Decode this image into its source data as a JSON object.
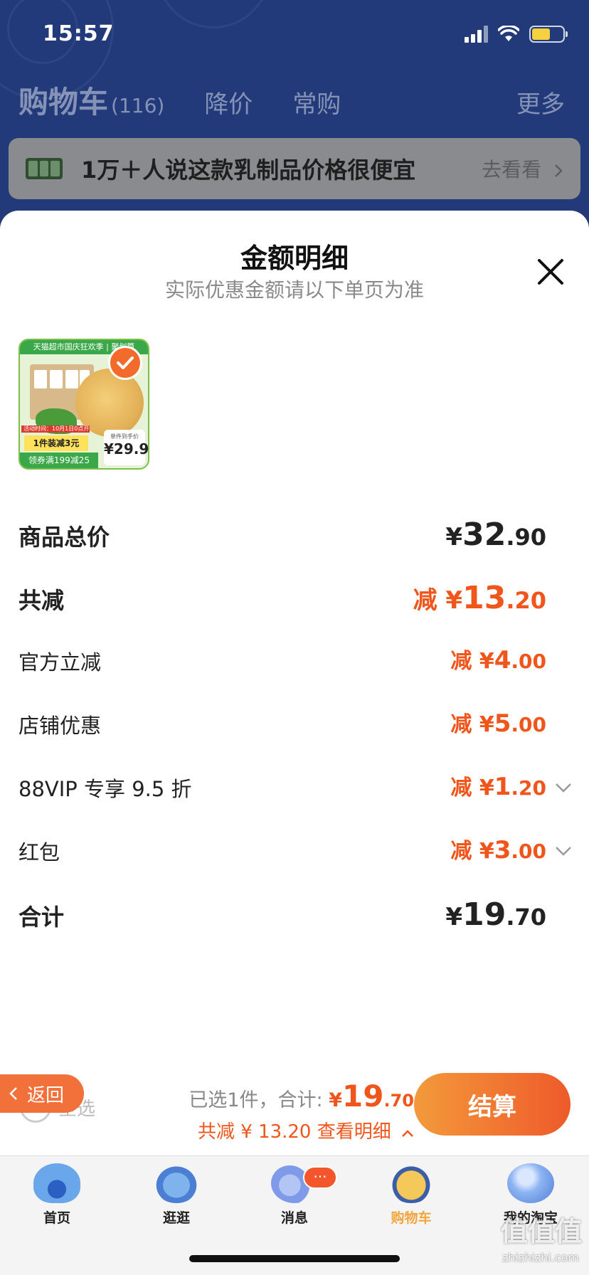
{
  "status_bar": {
    "time": "15:57"
  },
  "cart_header": {
    "title": "购物车",
    "count": "(116)",
    "tabs": [
      "降价",
      "常购"
    ],
    "more": "更多"
  },
  "promo": {
    "text": "1万＋人说这款乳制品价格很便宜",
    "link": "去看看"
  },
  "sheet": {
    "title": "金额明细",
    "subtitle": "实际优惠金额请以下单页为准",
    "product": {
      "banner": "天猫超市国庆狂欢季 | 聚划算",
      "event": "活动时间：10月1日0点开抢",
      "tag1": "1件装减3元",
      "tag2": "领券满199减25",
      "price_label": "单件到手价",
      "price": "¥29.9"
    },
    "rows": [
      {
        "label": "商品总价",
        "prefix": "",
        "currency": "¥",
        "int": "32",
        "dec": ".90"
      },
      {
        "label": "共减",
        "prefix": "减 ",
        "currency": "¥",
        "int": "13",
        "dec": ".20"
      },
      {
        "label": "官方立减",
        "prefix": "减 ",
        "currency": "¥",
        "int": "4",
        "dec": ".00"
      },
      {
        "label": "店铺优惠",
        "prefix": "减 ",
        "currency": "¥",
        "int": "5",
        "dec": ".00"
      },
      {
        "label": "88VIP 专享 9.5 折",
        "prefix": "减 ",
        "currency": "¥",
        "int": "1",
        "dec": ".20"
      },
      {
        "label": "红包",
        "prefix": "减 ",
        "currency": "¥",
        "int": "3",
        "dec": ".00"
      },
      {
        "label": "合计",
        "prefix": "",
        "currency": "¥",
        "int": "19",
        "dec": ".70"
      }
    ]
  },
  "checkout": {
    "back": "返回",
    "select_all": "全选",
    "selected_text": "已选1件，合计:",
    "currency": "¥",
    "total_int": "19",
    "total_dec": ".70",
    "discount_text": "共减 ¥ 13.20  查看明细",
    "settle": "结算"
  },
  "tabbar": {
    "items": [
      {
        "label": "首页",
        "icon": "home-icon"
      },
      {
        "label": "逛逛",
        "icon": "explore-icon"
      },
      {
        "label": "消息",
        "icon": "message-icon",
        "badge": "···"
      },
      {
        "label": "购物车",
        "icon": "cart-icon"
      },
      {
        "label": "我的淘宝",
        "icon": "profile-icon"
      }
    ],
    "active_index": 3
  },
  "watermark": {
    "text": "值值值",
    "sub": "zhizhizhi.com"
  },
  "colors": {
    "accent": "#f0561c",
    "header_bg": "#223a7a",
    "settle_start": "#f39a3b",
    "settle_end": "#ee5a2a"
  }
}
